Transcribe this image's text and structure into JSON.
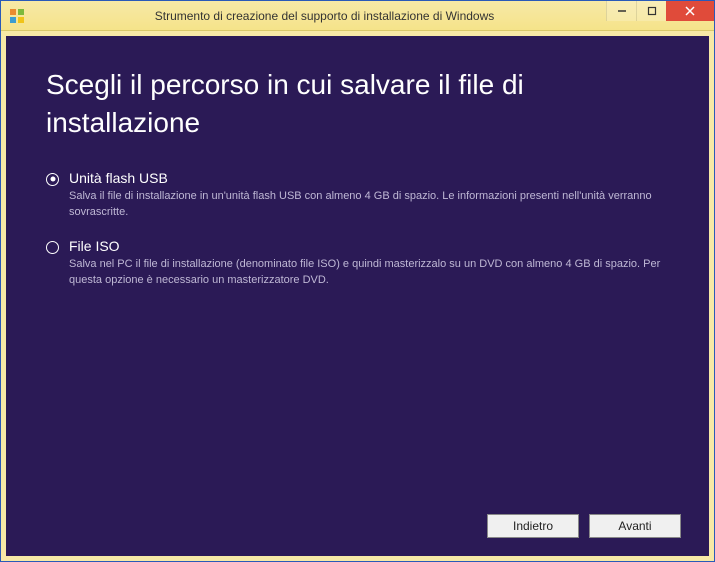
{
  "window": {
    "title": "Strumento di creazione del supporto di installazione di Windows"
  },
  "heading": "Scegli il percorso in cui salvare il file di installazione",
  "options": {
    "usb": {
      "label": "Unità flash USB",
      "description": "Salva il file di installazione in un'unità flash USB con almeno 4 GB di spazio. Le informazioni presenti nell'unità verranno sovrascritte.",
      "selected": true
    },
    "iso": {
      "label": "File ISO",
      "description": "Salva nel PC il file di installazione (denominato file ISO) e quindi masterizzalo su un DVD con almeno 4 GB di spazio. Per questa opzione è necessario un masterizzatore DVD.",
      "selected": false
    }
  },
  "buttons": {
    "back": "Indietro",
    "next": "Avanti"
  }
}
